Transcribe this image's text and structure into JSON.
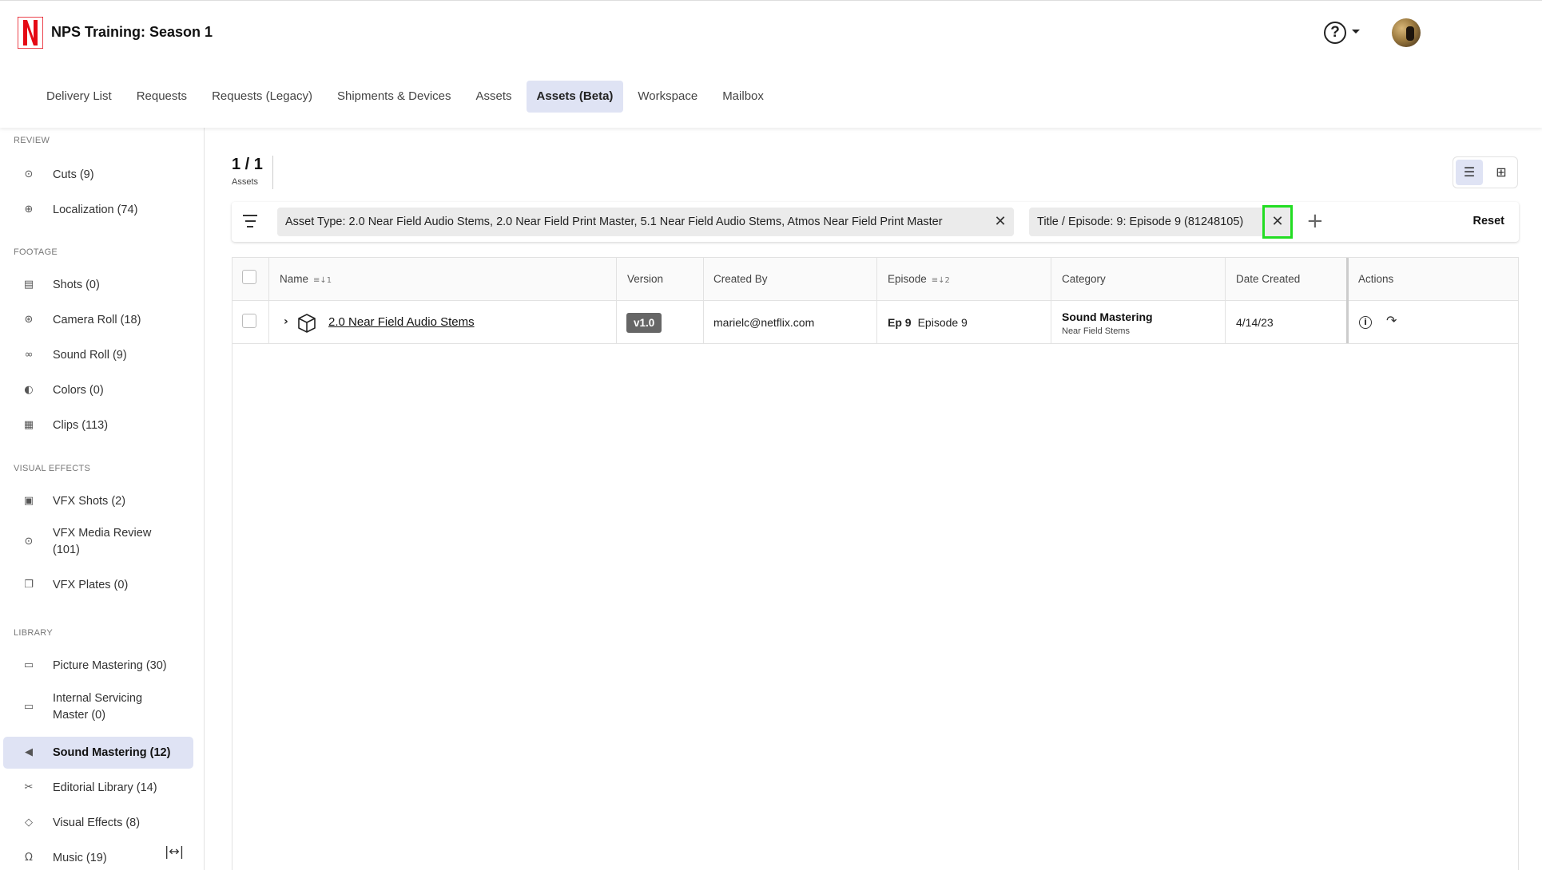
{
  "app": {
    "title": "NPS Training: Season 1",
    "brand_color": "#e50914",
    "accent_color": "#dfe3f4"
  },
  "header": {
    "help_icon": "help-circle-icon",
    "help_glyph": "?"
  },
  "nav": {
    "tabs": [
      {
        "label": "Delivery List"
      },
      {
        "label": "Requests"
      },
      {
        "label": "Requests (Legacy)"
      },
      {
        "label": "Shipments & Devices"
      },
      {
        "label": "Assets"
      },
      {
        "label": "Assets (Beta)"
      },
      {
        "label": "Workspace"
      },
      {
        "label": "Mailbox"
      }
    ],
    "active_tab": "Assets (Beta)"
  },
  "sidebar": {
    "sections": [
      {
        "heading": "REVIEW"
      },
      {
        "heading": "FOOTAGE"
      },
      {
        "heading": "VISUAL EFFECTS"
      },
      {
        "heading": "LIBRARY"
      }
    ],
    "items": [
      {
        "label": "Cuts (9)",
        "icon": "play-circle-icon",
        "glyph": "⊙"
      },
      {
        "label": "Localization (74)",
        "icon": "globe-icon",
        "glyph": "⊕"
      },
      {
        "label": "Shots (0)",
        "icon": "shots-icon",
        "glyph": "▤"
      },
      {
        "label": "Camera Roll (18)",
        "icon": "camera-roll-icon",
        "glyph": "⊛"
      },
      {
        "label": "Sound Roll (9)",
        "icon": "tape-icon",
        "glyph": "∞"
      },
      {
        "label": "Colors (0)",
        "icon": "drop-icon",
        "glyph": "◐"
      },
      {
        "label": "Clips (113)",
        "icon": "film-icon",
        "glyph": "▦"
      },
      {
        "label": "VFX Shots (2)",
        "icon": "vfx-shots-icon",
        "glyph": "▣"
      },
      {
        "label": "VFX Media Review (101)",
        "label_line1": "VFX Media Review",
        "label_line2": "(101)",
        "icon": "play-circle-icon",
        "glyph": "⊙"
      },
      {
        "label": "VFX Plates (0)",
        "icon": "plates-icon",
        "glyph": "❐"
      },
      {
        "label": "Picture Mastering (30)",
        "icon": "monitor-icon",
        "glyph": "▭"
      },
      {
        "label": "Internal Servicing Master (0)",
        "label_line1": "Internal Servicing",
        "label_line2": "Master (0)",
        "icon": "monitor-icon",
        "glyph": "▭"
      },
      {
        "label": "Sound Mastering (12)",
        "icon": "speaker-icon",
        "glyph": "◀"
      },
      {
        "label": "Editorial Library (14)",
        "icon": "scissors-icon",
        "glyph": "✂"
      },
      {
        "label": "Visual Effects (8)",
        "icon": "vfx-icon",
        "glyph": "◇"
      },
      {
        "label": "Music (19)",
        "icon": "headphones-icon",
        "glyph": "Ω"
      }
    ],
    "active_item": "Sound Mastering (12)",
    "collapse_glyph": "|↔|"
  },
  "summary": {
    "count": "1 / 1",
    "label": "Assets"
  },
  "view_toggle": {
    "list_glyph": "☰",
    "grid_glyph": "⊞",
    "active": "list"
  },
  "filters": {
    "chips": [
      {
        "label": "Asset Type: 2.0 Near Field Audio Stems, 2.0 Near Field Print Master, 5.1 Near Field Audio Stems, Atmos Near Field Print Master"
      },
      {
        "label": "Title / Episode: 9: Episode 9 (81248105)"
      }
    ],
    "close_glyph": "✕",
    "add_glyph": "+",
    "reset_label": "Reset"
  },
  "table": {
    "columns": [
      {
        "label": "Name",
        "sort": "≡↓1"
      },
      {
        "label": "Version",
        "sort": ""
      },
      {
        "label": "Created By",
        "sort": ""
      },
      {
        "label": "Episode",
        "sort": "≡↓2"
      },
      {
        "label": "Category",
        "sort": ""
      },
      {
        "label": "Date Created",
        "sort": ""
      },
      {
        "label": "Actions",
        "sort": ""
      }
    ],
    "rows": [
      {
        "expand_glyph": "›",
        "name": "2.0 Near Field Audio Stems",
        "version": "v1.0",
        "created_by": "marielc@netflix.com",
        "episode_num": "Ep 9",
        "episode_title": "Episode 9",
        "category": "Sound Mastering",
        "subcategory": "Near Field Stems",
        "date_created": "4/14/23",
        "actions": [
          {
            "icon": "info-icon",
            "glyph": "i"
          },
          {
            "icon": "share-icon",
            "glyph": "↷"
          }
        ]
      }
    ]
  }
}
